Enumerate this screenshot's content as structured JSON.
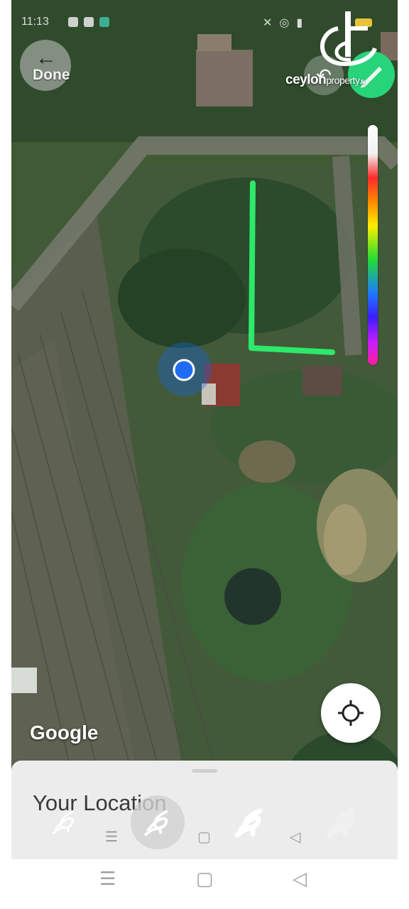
{
  "status_bar": {
    "time": "11:13"
  },
  "toolbar": {
    "done_label": "Done",
    "back_icon": "arrow-left-icon",
    "undo_icon": "undo-icon",
    "pen_icon": "pen-icon"
  },
  "watermark": {
    "brand": "ceylon",
    "brand_sub": "property",
    "brand_tld": ".lk"
  },
  "map": {
    "attribution": "Google",
    "drawn_stroke_color": "#2ee86a",
    "location_dot_color": "#1565e8"
  },
  "bottom_sheet": {
    "title": "Your Location"
  },
  "brushes": [
    "brush-thin-icon",
    "brush-marker-icon",
    "brush-thick-icon",
    "brush-pattern-icon"
  ],
  "colors": {
    "accent": "#28d47a",
    "sheet_bg": "#ececec"
  }
}
